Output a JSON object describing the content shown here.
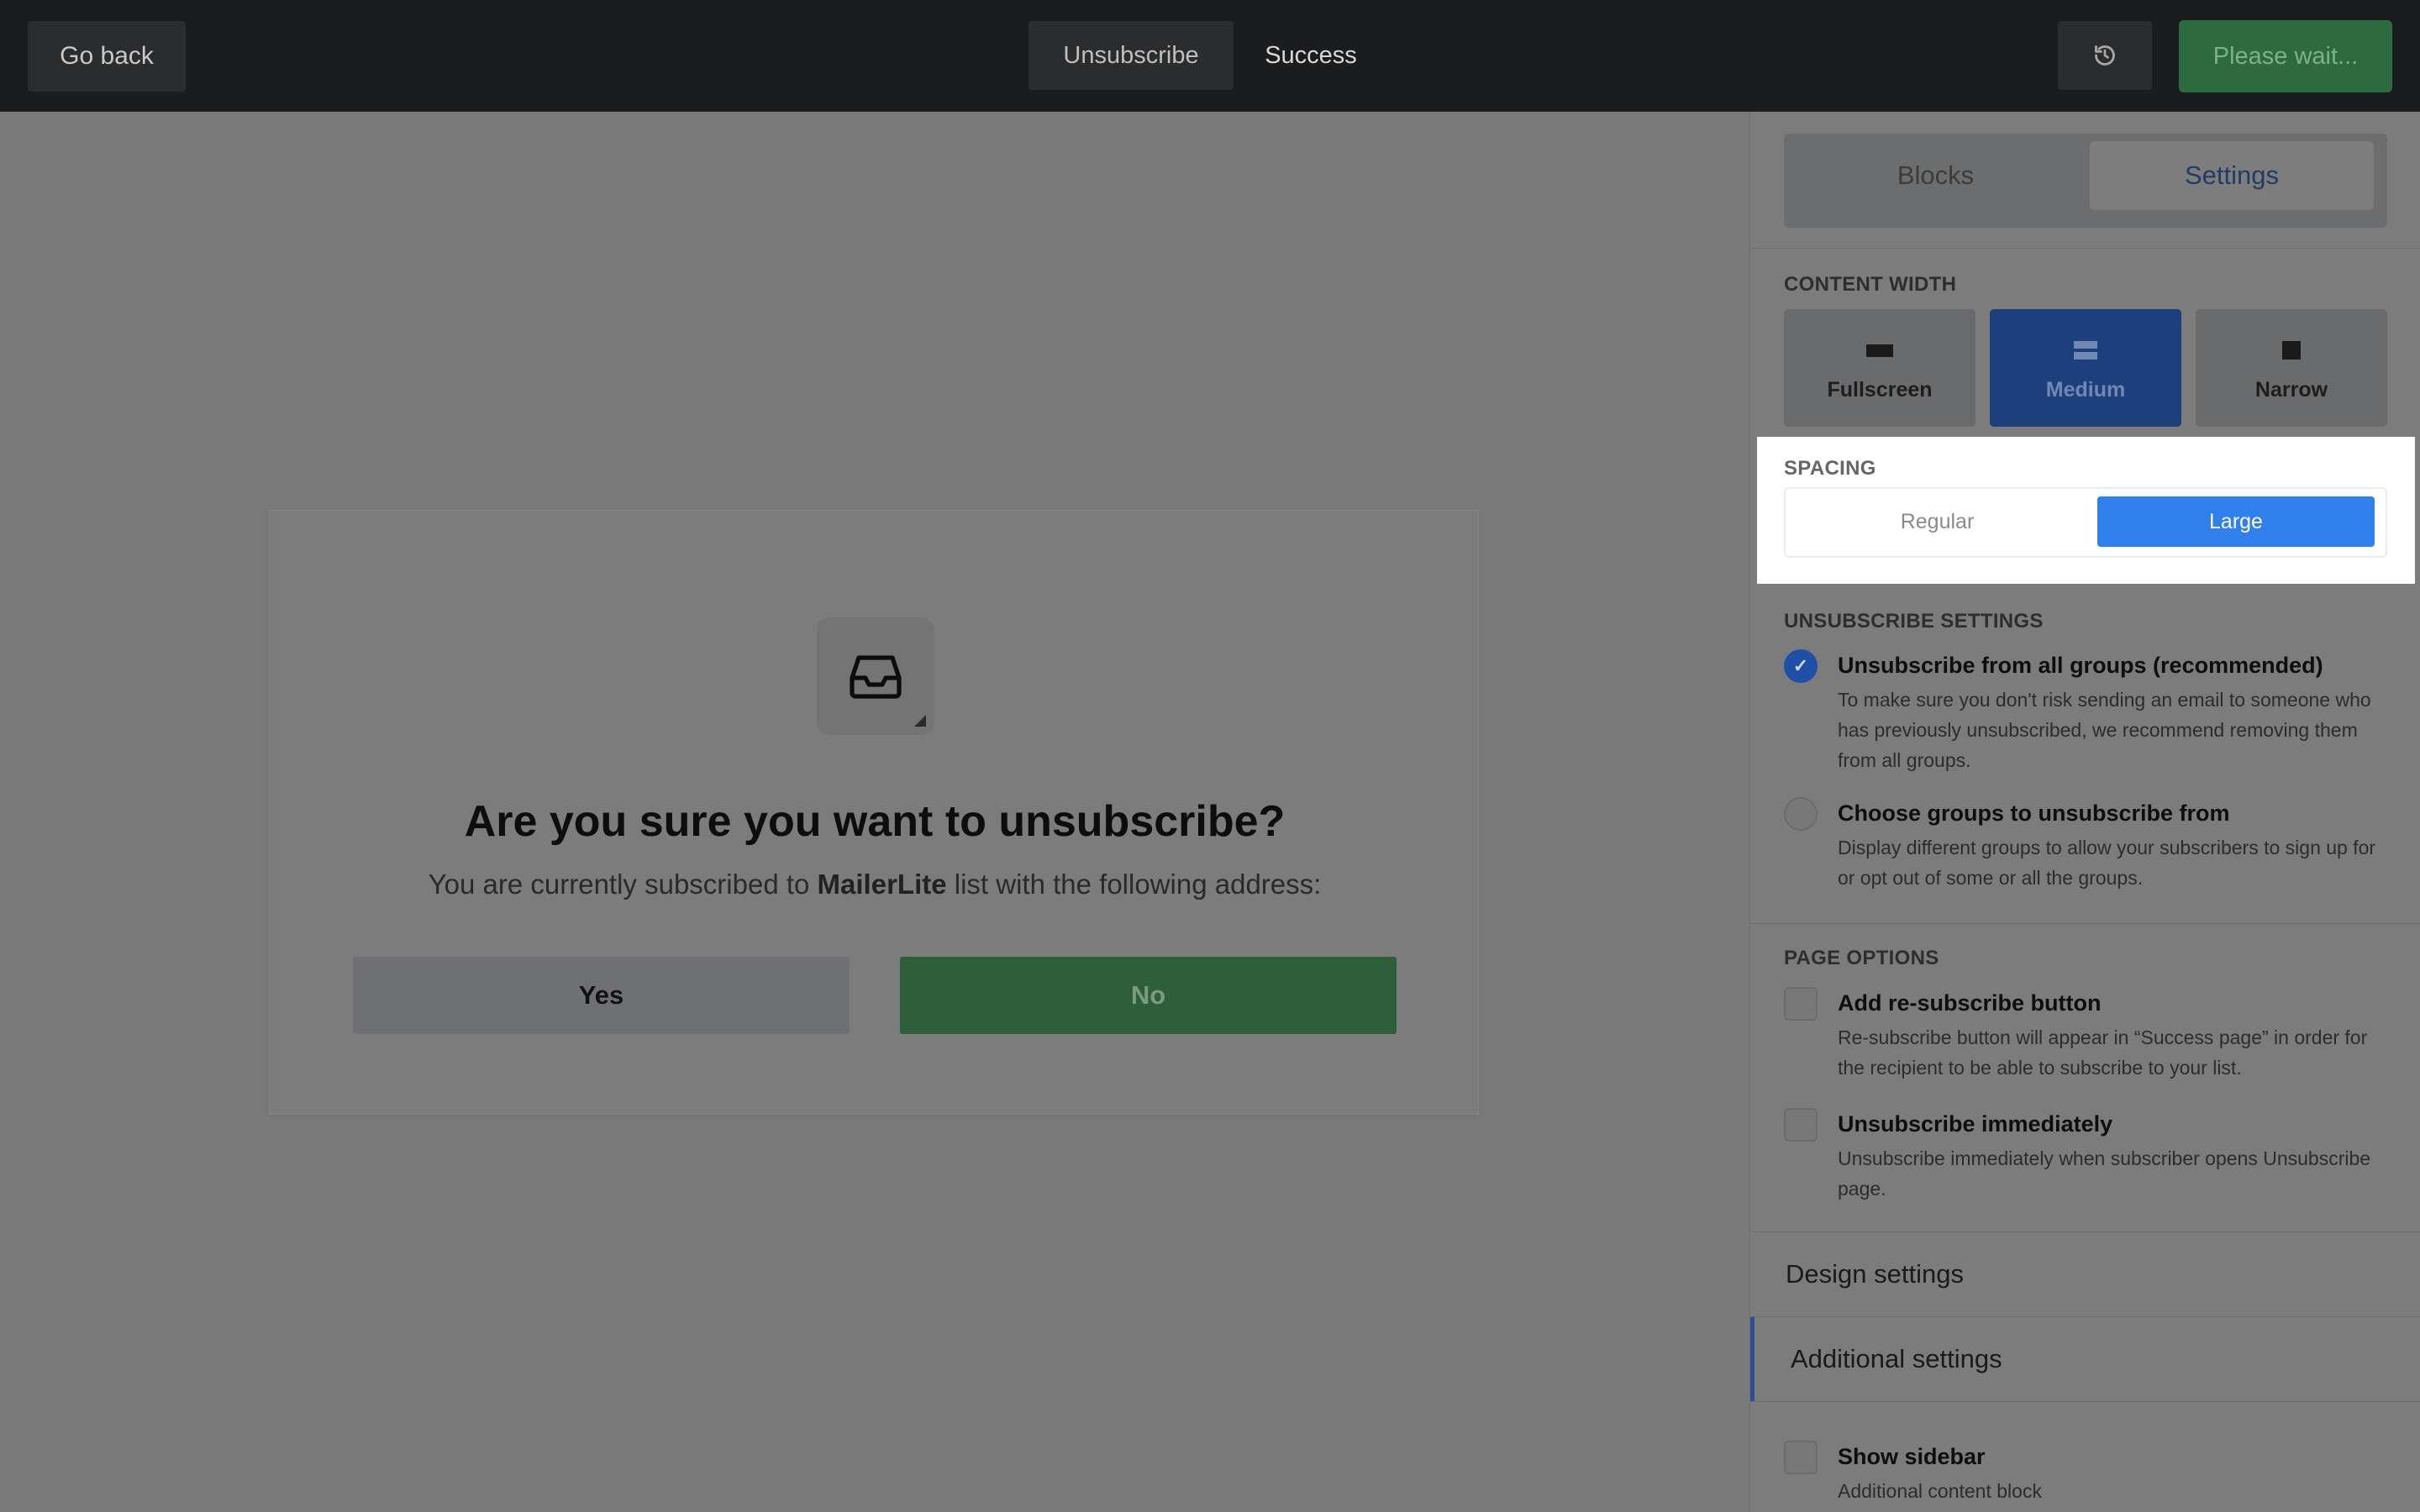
{
  "topbar": {
    "go_back": "Go back",
    "tabs": [
      {
        "label": "Unsubscribe"
      },
      {
        "label": "Success"
      }
    ],
    "history_icon": "history-icon",
    "please_wait": "Please wait..."
  },
  "card": {
    "icon": "inbox-icon",
    "title": "Are you sure you want to unsubscribe?",
    "subtitle_prefix": "You are currently subscribed to",
    "subtitle_brand": "MailerLite",
    "subtitle_suffix": "list with the following address:",
    "yes_label": "Yes",
    "no_label": "No"
  },
  "sidebar": {
    "tabs": {
      "blocks": "Blocks",
      "settings": "Settings"
    },
    "content_width": {
      "label": "CONTENT WIDTH",
      "options": [
        {
          "label": "Fullscreen"
        },
        {
          "label": "Medium"
        },
        {
          "label": "Narrow"
        }
      ],
      "selected": "Medium"
    },
    "spacing": {
      "label": "SPACING",
      "regular": "Regular",
      "large": "Large",
      "selected": "Large"
    },
    "unsubscribe_settings": {
      "label": "UNSUBSCRIBE SETTINGS",
      "options": [
        {
          "title": "Unsubscribe from all groups (recommended)",
          "desc": "To make sure you don't risk sending an email to someone who has previously unsubscribed, we recommend removing them from all groups.",
          "checked": true
        },
        {
          "title": "Choose groups to unsubscribe from",
          "desc": "Display different groups to allow your subscribers to sign up for or opt out of some or all the groups.",
          "checked": false
        }
      ]
    },
    "page_options": {
      "label": "PAGE OPTIONS",
      "options": [
        {
          "title": "Add re-subscribe button",
          "desc": "Re-subscribe button will appear in “Success page” in order for the recipient to be able to subscribe to your list."
        },
        {
          "title": "Unsubscribe immediately",
          "desc": "Unsubscribe immediately when subscriber opens Unsubscribe page."
        }
      ]
    },
    "design_settings": "Design settings",
    "additional_settings": "Additional settings",
    "show_sidebar": {
      "title": "Show sidebar",
      "desc": "Additional content block"
    }
  },
  "colors": {
    "accent_blue": "#2f80ed",
    "success_green": "#2e7d43",
    "topbar_bg": "#1b1c1e"
  }
}
